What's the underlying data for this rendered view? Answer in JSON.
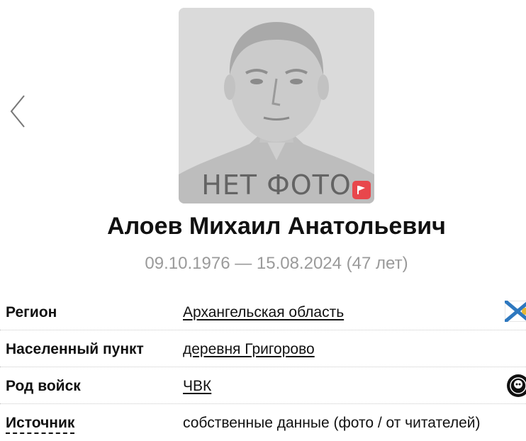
{
  "nav": {
    "prev_icon": "chevron-left-icon"
  },
  "photo": {
    "placeholder_text": "НЕТ ФОТО",
    "flag_icon": "flag-icon",
    "flag_color": "#e8474c"
  },
  "person": {
    "name": "Алоев Михаил Анатольевич",
    "dates": "09.10.1976 — 15.08.2024 (47 лет)"
  },
  "info": [
    {
      "label": "Регион",
      "value": "Архангельская область",
      "link": true,
      "icon": "region-flag-icon"
    },
    {
      "label": "Населенный пункт",
      "value": "деревня Григорово",
      "link": true
    },
    {
      "label": "Род войск",
      "value": "ЧВК",
      "link": true,
      "icon": "pmc-emblem-icon"
    },
    {
      "label": "Источник",
      "value": "собственные данные (фото / от читателей)",
      "link": false
    }
  ]
}
